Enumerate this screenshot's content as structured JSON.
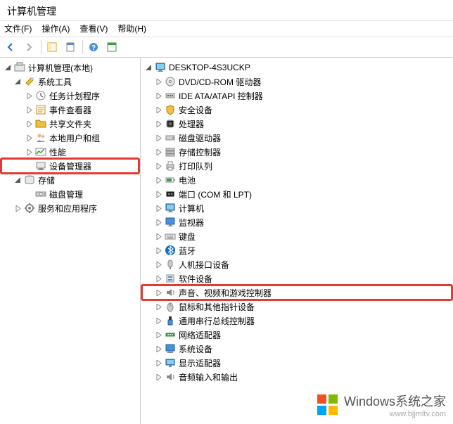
{
  "title": "计算机管理",
  "menu": {
    "file": "文件(F)",
    "action": "操作(A)",
    "view": "查看(V)",
    "help": "帮助(H)"
  },
  "left_tree": {
    "root": "计算机管理(本地)",
    "nodes": [
      {
        "label": "系统工具",
        "icon": "tools",
        "exp": "expanded",
        "children": [
          {
            "label": "任务计划程序",
            "icon": "scheduler",
            "exp": "collapsed"
          },
          {
            "label": "事件查看器",
            "icon": "eventviewer",
            "exp": "collapsed"
          },
          {
            "label": "共享文件夹",
            "icon": "sharedfolders",
            "exp": "collapsed"
          },
          {
            "label": "本地用户和组",
            "icon": "users",
            "exp": "collapsed"
          },
          {
            "label": "性能",
            "icon": "performance",
            "exp": "collapsed"
          },
          {
            "label": "设备管理器",
            "icon": "devicemgr",
            "exp": "none",
            "highlight": true
          }
        ]
      },
      {
        "label": "存储",
        "icon": "storage",
        "exp": "expanded",
        "children": [
          {
            "label": "磁盘管理",
            "icon": "diskmgr",
            "exp": "none"
          }
        ]
      },
      {
        "label": "服务和应用程序",
        "icon": "services",
        "exp": "collapsed"
      }
    ]
  },
  "right_tree": {
    "root": "DESKTOP-4S3UCKP",
    "nodes": [
      {
        "label": "DVD/CD-ROM 驱动器",
        "icon": "dvd",
        "exp": "collapsed"
      },
      {
        "label": "IDE ATA/ATAPI 控制器",
        "icon": "ide",
        "exp": "collapsed"
      },
      {
        "label": "安全设备",
        "icon": "security",
        "exp": "collapsed"
      },
      {
        "label": "处理器",
        "icon": "cpu",
        "exp": "collapsed"
      },
      {
        "label": "磁盘驱动器",
        "icon": "disk",
        "exp": "collapsed"
      },
      {
        "label": "存储控制器",
        "icon": "storagectl",
        "exp": "collapsed"
      },
      {
        "label": "打印队列",
        "icon": "printer",
        "exp": "collapsed"
      },
      {
        "label": "电池",
        "icon": "battery",
        "exp": "collapsed"
      },
      {
        "label": "端口 (COM 和 LPT)",
        "icon": "port",
        "exp": "collapsed"
      },
      {
        "label": "计算机",
        "icon": "computer",
        "exp": "collapsed"
      },
      {
        "label": "监视器",
        "icon": "monitor",
        "exp": "collapsed"
      },
      {
        "label": "键盘",
        "icon": "keyboard",
        "exp": "collapsed"
      },
      {
        "label": "蓝牙",
        "icon": "bluetooth",
        "exp": "collapsed"
      },
      {
        "label": "人机接口设备",
        "icon": "hid",
        "exp": "collapsed"
      },
      {
        "label": "软件设备",
        "icon": "software",
        "exp": "collapsed"
      },
      {
        "label": "声音、视频和游戏控制器",
        "icon": "sound",
        "exp": "collapsed",
        "highlight": true
      },
      {
        "label": "鼠标和其他指针设备",
        "icon": "mouse",
        "exp": "collapsed"
      },
      {
        "label": "通用串行总线控制器",
        "icon": "usb",
        "exp": "collapsed"
      },
      {
        "label": "网络适配器",
        "icon": "network",
        "exp": "collapsed"
      },
      {
        "label": "系统设备",
        "icon": "system",
        "exp": "collapsed"
      },
      {
        "label": "显示适配器",
        "icon": "display",
        "exp": "collapsed"
      },
      {
        "label": "音频输入和输出",
        "icon": "audio",
        "exp": "collapsed"
      }
    ]
  },
  "watermark": {
    "text": "Windows系统之家",
    "url": "www.bjjmltv.com"
  }
}
